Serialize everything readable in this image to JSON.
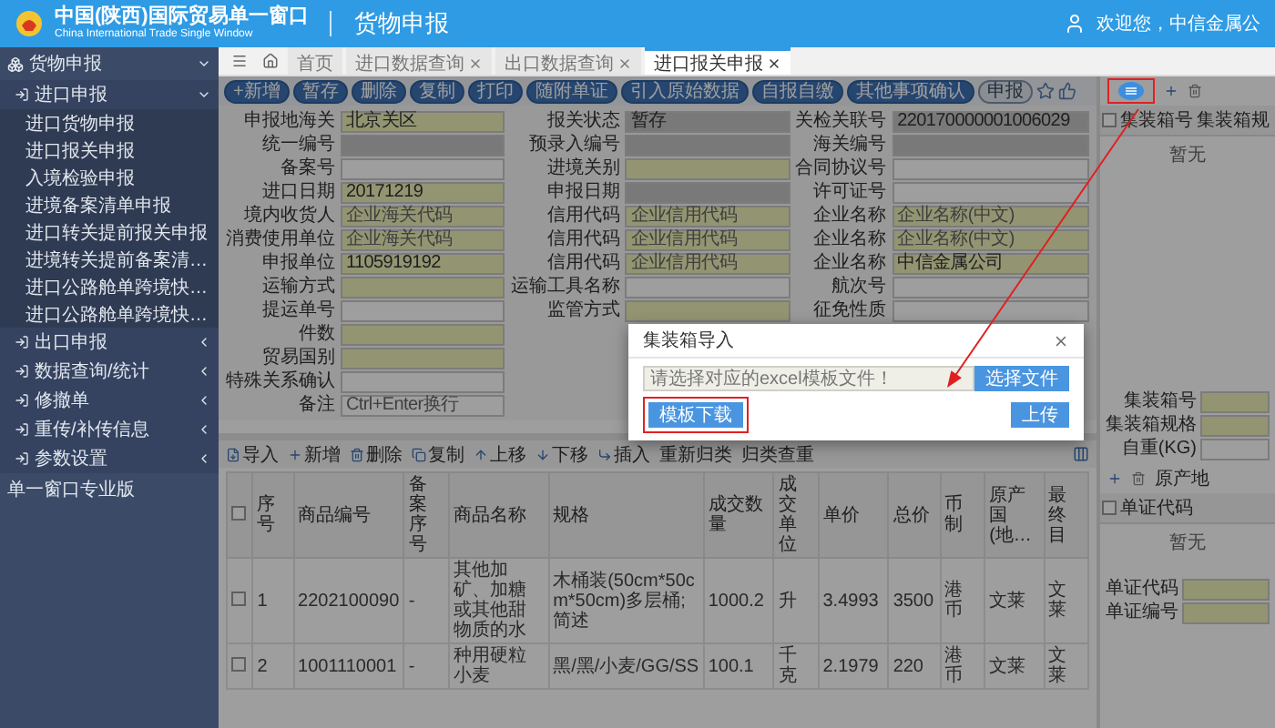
{
  "header": {
    "title": "中国(陕西)国际贸易单一窗口",
    "subtitle": "China International Trade Single Window",
    "module": "货物申报",
    "user": "欢迎您，中信金属公"
  },
  "sidebar": {
    "items": [
      {
        "label": "货物申报",
        "expanded": true,
        "children": [
          {
            "label": "进口申报",
            "expanded": true,
            "children": [
              {
                "label": "进口货物申报"
              },
              {
                "label": "进口报关申报"
              },
              {
                "label": "入境检验申报"
              },
              {
                "label": "进境备案清单申报"
              },
              {
                "label": "进口转关提前报关申报"
              },
              {
                "label": "进境转关提前备案清…"
              },
              {
                "label": "进口公路舱单跨境快…"
              },
              {
                "label": "进口公路舱单跨境快…"
              }
            ]
          },
          {
            "label": "出口申报",
            "expanded": false
          },
          {
            "label": "数据查询/统计",
            "expanded": false
          },
          {
            "label": "修撤单",
            "expanded": false
          },
          {
            "label": "重传/补传信息",
            "expanded": false
          },
          {
            "label": "参数设置",
            "expanded": false
          }
        ]
      },
      {
        "label": "单一窗口专业版"
      }
    ]
  },
  "tabs": [
    {
      "label": "首页",
      "selected": false,
      "closable": false
    },
    {
      "label": "进口数据查询",
      "selected": false,
      "closable": true
    },
    {
      "label": "出口数据查询",
      "selected": false,
      "closable": true
    },
    {
      "label": "进口报关申报",
      "selected": true,
      "closable": true
    }
  ],
  "toolbar": {
    "buttons": [
      {
        "label": "+新增",
        "disabled": false
      },
      {
        "label": "暂存",
        "disabled": false
      },
      {
        "label": "删除",
        "disabled": false
      },
      {
        "label": "复制",
        "disabled": false
      },
      {
        "label": "打印",
        "disabled": false
      },
      {
        "label": "随附单证",
        "disabled": false
      },
      {
        "label": "引入原始数据",
        "disabled": false
      },
      {
        "label": "自报自缴",
        "disabled": false
      },
      {
        "label": "其他事项确认",
        "disabled": false
      },
      {
        "label": "申报",
        "disabled": true
      }
    ]
  },
  "form": {
    "rows": [
      {
        "fields": [
          {
            "label": "申报地海关",
            "kind": "required",
            "value": "北京关区"
          },
          {
            "label": "报关状态",
            "kind": "readonly",
            "value": "暂存"
          },
          {
            "label": "关检关联号",
            "kind": "readonly",
            "value": "220170000001006029"
          }
        ]
      },
      {
        "fields": [
          {
            "label": "统一编号",
            "kind": "readonly"
          },
          {
            "label": "预录入编号",
            "kind": "readonly"
          },
          {
            "label": "海关编号",
            "kind": "readonly"
          }
        ]
      },
      {
        "fields": [
          {
            "label": "备案号",
            "kind": "text"
          },
          {
            "label": "进境关别",
            "kind": "required"
          },
          {
            "label": "合同协议号",
            "kind": "text"
          }
        ]
      },
      {
        "fields": [
          {
            "label": "进口日期",
            "kind": "required",
            "value": "20171219"
          },
          {
            "label": "申报日期",
            "kind": "readonly"
          },
          {
            "label": "许可证号",
            "kind": "text"
          }
        ]
      },
      {
        "fields": [
          {
            "label": "境内收货人",
            "kind": "required",
            "placeholder": "企业海关代码"
          },
          {
            "label": "信用代码",
            "kind": "required",
            "placeholder": "企业信用代码"
          },
          {
            "label": "企业名称",
            "kind": "required",
            "placeholder": "企业名称(中文)"
          }
        ]
      },
      {
        "fields": [
          {
            "label": "消费使用单位",
            "kind": "required",
            "placeholder": "企业海关代码"
          },
          {
            "label": "信用代码",
            "kind": "required",
            "placeholder": "企业信用代码"
          },
          {
            "label": "企业名称",
            "kind": "required",
            "placeholder": "企业名称(中文)"
          }
        ]
      },
      {
        "fields": [
          {
            "label": "申报单位",
            "kind": "required",
            "value": "1105919192"
          },
          {
            "label": "信用代码",
            "kind": "required",
            "placeholder": "企业信用代码"
          },
          {
            "label": "企业名称",
            "kind": "required",
            "value": "中信金属公司"
          }
        ]
      },
      {
        "fields": [
          {
            "label": "运输方式",
            "kind": "required"
          },
          {
            "label": "运输工具名称",
            "kind": "text"
          },
          {
            "label": "航次号",
            "kind": "text"
          }
        ]
      },
      {
        "fields": [
          {
            "label": "提运单号",
            "kind": "text"
          },
          {
            "label": "监管方式",
            "kind": "required"
          },
          {
            "label": "征免性质",
            "kind": "text"
          }
        ]
      },
      {
        "fields": [
          {
            "label": "件数",
            "kind": "required"
          }
        ]
      },
      {
        "fields": [
          {
            "label": "贸易国别",
            "kind": "required"
          }
        ]
      },
      {
        "fields": [
          {
            "label": "特殊关系确认",
            "kind": "text"
          }
        ]
      },
      {
        "fields": [
          {
            "label": "备注",
            "kind": "text",
            "placeholder": "Ctrl+Enter换行"
          }
        ]
      }
    ]
  },
  "goods": {
    "select_all_checked": false,
    "toolbar": [
      "导入",
      "新增",
      "删除",
      "复制",
      "上移",
      "下移",
      "插入",
      "重新归类",
      "归类查重"
    ],
    "columns": [
      "序号",
      "商品编号",
      "备案序号",
      "商品名称",
      "规格",
      "成交数量",
      "成交单位",
      "单价",
      "总价",
      "币制",
      "原产国(地…",
      "最终目"
    ],
    "rows": [
      {
        "checked": false,
        "cells": [
          "1",
          "2202100090",
          "-",
          "其他加矿、加糖或其他甜物质的水",
          "木桶装(50cm*50cm*50cm)多层桶;简述",
          "1000.2",
          "升",
          "3.4993",
          "3500",
          "港币",
          "文莱",
          "文莱"
        ]
      },
      {
        "checked": false,
        "cells": [
          "2",
          "1001110001",
          "-",
          "种用硬粒小麦",
          "黑/黑/小麦/GG/SS",
          "100.1",
          "千克",
          "2.1979",
          "220",
          "港币",
          "文莱",
          "文莱"
        ]
      }
    ]
  },
  "container_panel": {
    "highlighted": true,
    "select_all_checked": false,
    "columns": [
      "集装箱号",
      "集装箱规"
    ],
    "empty_text": "暂无",
    "fields": [
      {
        "label": "集装箱号",
        "kind": "required"
      },
      {
        "label": "集装箱规格",
        "kind": "required"
      },
      {
        "label": "自重(KG)",
        "kind": "text"
      }
    ]
  },
  "documents_panel": {
    "label": "原产地",
    "select_all_checked": false,
    "columns": [
      "单证代码"
    ],
    "empty_text": "暂无",
    "fields": [
      {
        "label": "单证代码",
        "kind": "required"
      },
      {
        "label": "单证编号",
        "kind": "required"
      }
    ]
  },
  "dialog": {
    "title": "集装箱导入",
    "file_placeholder": "请选择对应的excel模板文件！",
    "choose_button": "选择文件",
    "template_button": {
      "label": "模板下载",
      "highlighted": true
    },
    "upload_button": "上传"
  }
}
